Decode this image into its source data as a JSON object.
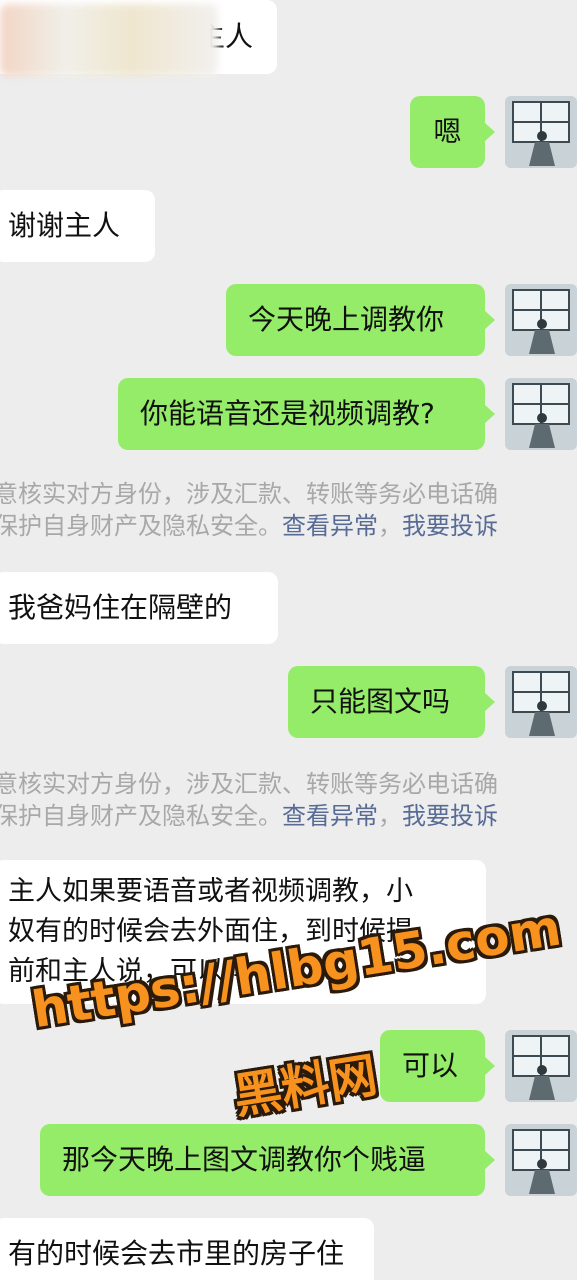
{
  "messages": [
    {
      "side": "left",
      "text": "主人"
    },
    {
      "side": "right",
      "text": "嗯"
    },
    {
      "side": "left",
      "text": "谢谢主人"
    },
    {
      "side": "right",
      "text": "今天晚上调教你"
    },
    {
      "side": "right",
      "text": "你能语音还是视频调教?"
    },
    {
      "side": "left",
      "text": "我爸妈住在隔壁的"
    },
    {
      "side": "right",
      "text": "只能图文吗"
    },
    {
      "side": "left",
      "lines": [
        "主人如果要语音或者视频调教，小",
        "奴有的时候会去外面住，到时候提",
        "前和主人说，可以吗"
      ]
    },
    {
      "side": "right",
      "text": "可以"
    },
    {
      "side": "right",
      "text": "那今天晚上图文调教你个贱逼"
    },
    {
      "side": "left",
      "text": "有的时候会去市里的房子住"
    }
  ],
  "security_notice": {
    "line1": "意核实对方身份，涉及汇款、转账等务必电话确",
    "line2_prefix": "保护自身财产及隐私安全。",
    "view_exception": "查看异常",
    "separator": "，",
    "report": "我要投诉"
  },
  "watermark": {
    "url": "https://hlbg15.com",
    "name": "黑料网",
    "color": "#f7921e"
  },
  "colors": {
    "background": "#ededed",
    "sent_bubble": "#95ec69",
    "received_bubble": "#ffffff",
    "link": "#576b95",
    "notice_text": "#a8a8a8"
  }
}
